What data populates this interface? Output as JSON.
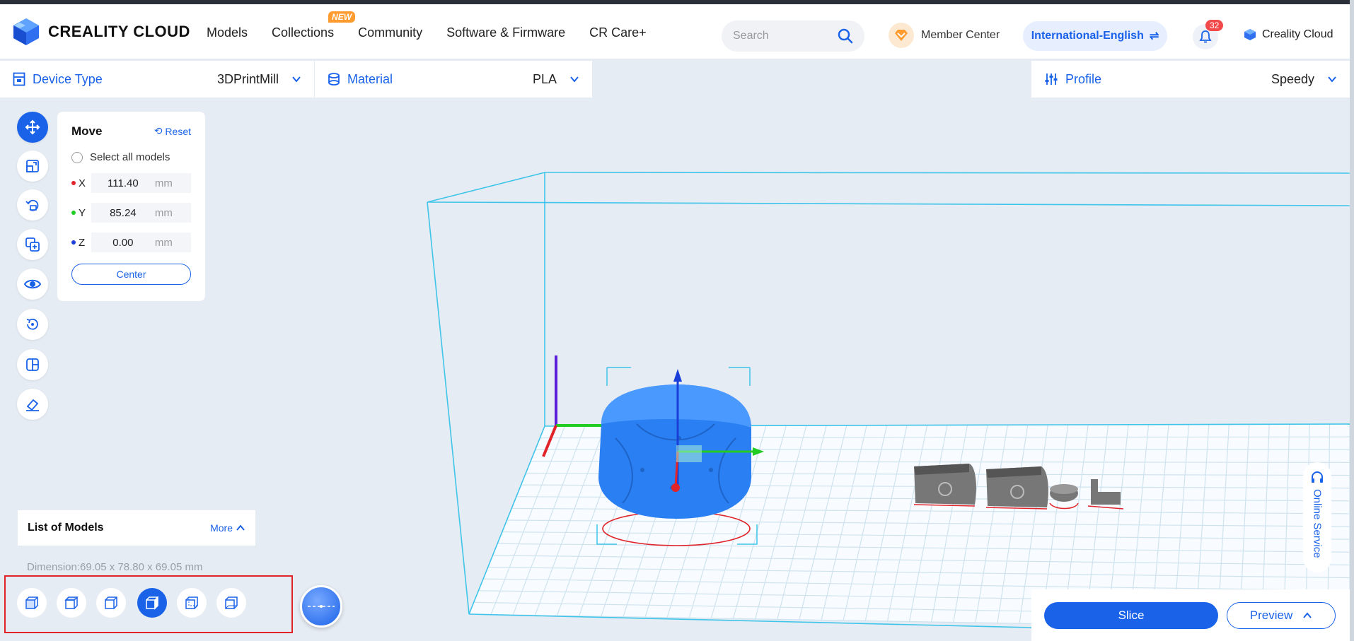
{
  "header": {
    "brand": "CREALITY CLOUD",
    "nav": [
      "Models",
      "Collections",
      "Community",
      "Software & Firmware",
      "CR Care+"
    ],
    "new_badge": "NEW",
    "search_placeholder": "Search",
    "member_center": "Member Center",
    "language": "International-English",
    "notification_count": "32",
    "account": "Creality Cloud"
  },
  "selectors": {
    "device_label": "Device Type",
    "device_value": "3DPrintMill",
    "material_label": "Material",
    "material_value": "PLA",
    "profile_label": "Profile",
    "profile_value": "Speedy"
  },
  "move_panel": {
    "title": "Move",
    "reset": "Reset",
    "select_all": "Select all models",
    "x_label": "X",
    "x_value": "111.40",
    "y_label": "Y",
    "y_value": "85.24",
    "z_label": "Z",
    "z_value": "0.00",
    "unit": "mm",
    "center": "Center"
  },
  "models_list": {
    "title": "List of Models",
    "more": "More",
    "dimension": "Dimension:69.05 x 78.80 x 69.05 mm"
  },
  "actions": {
    "slice": "Slice",
    "preview": "Preview",
    "online_service": "Online Service"
  },
  "colors": {
    "accent": "#1a62e8",
    "highlight_box": "#e0242a",
    "build_volume": "#3fc4ea"
  }
}
